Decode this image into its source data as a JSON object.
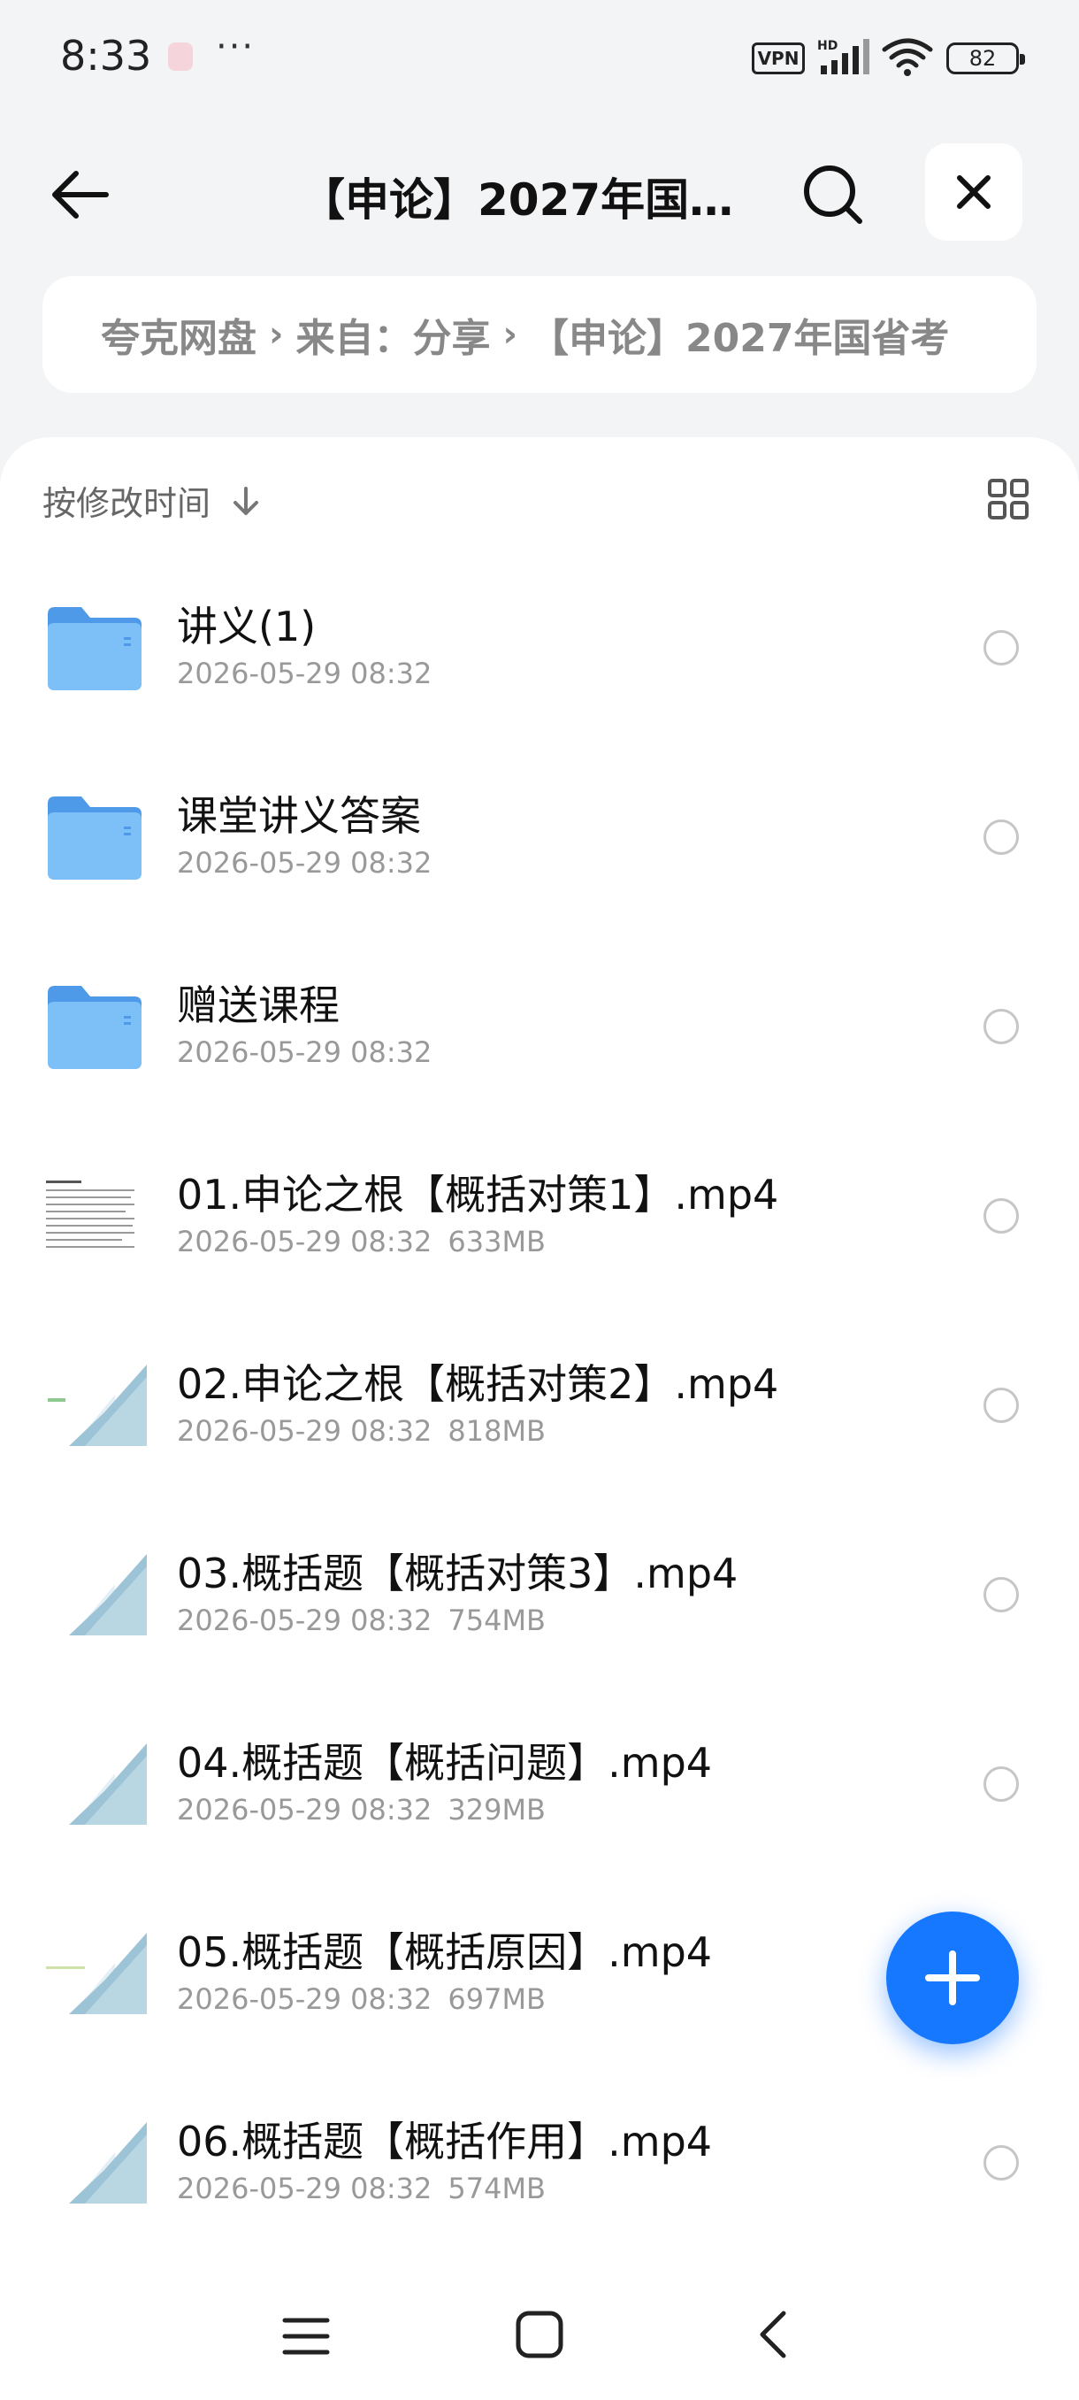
{
  "status_bar": {
    "time": "8:33",
    "dots": "···",
    "vpn": "VPN",
    "battery": "82"
  },
  "header": {
    "title": "【申论】2027年国…"
  },
  "breadcrumb": {
    "items": [
      "夸克网盘",
      "来自：分享",
      "【申论】2027年国省考"
    ]
  },
  "toolbar": {
    "sort_label": "按修改时间"
  },
  "files": [
    {
      "name": "讲义(1)",
      "date": "2026-05-29 08:32",
      "size": "",
      "type": "folder"
    },
    {
      "name": "课堂讲义答案",
      "date": "2026-05-29 08:32",
      "size": "",
      "type": "folder"
    },
    {
      "name": "赠送课程",
      "date": "2026-05-29 08:32",
      "size": "",
      "type": "folder"
    },
    {
      "name": "01.申论之根【概括对策1】.mp4",
      "date": "2026-05-29 08:32",
      "size": "633MB",
      "type": "video-doc"
    },
    {
      "name": "02.申论之根【概括对策2】.mp4",
      "date": "2026-05-29 08:32",
      "size": "818MB",
      "type": "video"
    },
    {
      "name": "03.概括题【概括对策3】.mp4",
      "date": "2026-05-29 08:32",
      "size": "754MB",
      "type": "video"
    },
    {
      "name": "04.概括题【概括问题】.mp4",
      "date": "2026-05-29 08:32",
      "size": "329MB",
      "type": "video"
    },
    {
      "name": "05.概括题【概括原因】.mp4",
      "date": "2026-05-29 08:32",
      "size": "697MB",
      "type": "video"
    },
    {
      "name": "06.概括题【概括作用】.mp4",
      "date": "2026-05-29 08:32",
      "size": "574MB",
      "type": "video"
    }
  ],
  "colors": {
    "accent": "#1677ff",
    "folder": "#5aa9f0"
  },
  "icons": {
    "back": "arrow-left-icon",
    "search": "search-icon",
    "close": "close-icon",
    "sort": "arrow-down-icon",
    "view": "grid-view-icon",
    "add": "plus-icon"
  }
}
